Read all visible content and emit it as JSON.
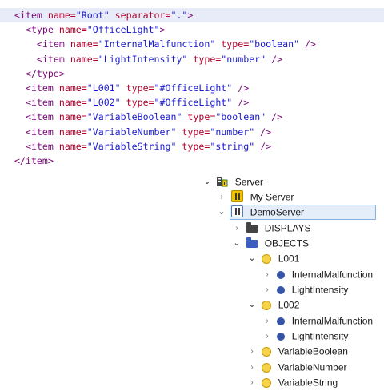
{
  "xml": {
    "lines": [
      {
        "indent": "",
        "parts": [
          [
            "tag",
            "<item "
          ],
          [
            "attr",
            "name="
          ],
          [
            "val",
            "\"Root\""
          ],
          [
            "attr",
            " separator="
          ],
          [
            "val",
            "\".\""
          ],
          [
            "tag",
            ">"
          ]
        ],
        "highlight": true
      },
      {
        "indent": "  ",
        "parts": [
          [
            "tag",
            "<type "
          ],
          [
            "attr",
            "name="
          ],
          [
            "val",
            "\"OfficeLight\""
          ],
          [
            "tag",
            ">"
          ]
        ]
      },
      {
        "indent": "    ",
        "parts": [
          [
            "tag",
            "<item "
          ],
          [
            "attr",
            "name="
          ],
          [
            "val",
            "\"InternalMalfunction\""
          ],
          [
            "attr",
            " type="
          ],
          [
            "val",
            "\"boolean\""
          ],
          [
            "tag",
            " />"
          ]
        ]
      },
      {
        "indent": "    ",
        "parts": [
          [
            "tag",
            "<item "
          ],
          [
            "attr",
            "name="
          ],
          [
            "val",
            "\"LightIntensity\""
          ],
          [
            "attr",
            " type="
          ],
          [
            "val",
            "\"number\""
          ],
          [
            "tag",
            " />"
          ]
        ]
      },
      {
        "indent": "  ",
        "parts": [
          [
            "tag",
            "</type>"
          ]
        ]
      },
      {
        "indent": "  ",
        "parts": [
          [
            "tag",
            "<item "
          ],
          [
            "attr",
            "name="
          ],
          [
            "val",
            "\"L001\""
          ],
          [
            "attr",
            " type="
          ],
          [
            "val",
            "\"#OfficeLight\""
          ],
          [
            "tag",
            " />"
          ]
        ]
      },
      {
        "indent": "  ",
        "parts": [
          [
            "tag",
            "<item "
          ],
          [
            "attr",
            "name="
          ],
          [
            "val",
            "\"L002\""
          ],
          [
            "attr",
            " type="
          ],
          [
            "val",
            "\"#OfficeLight\""
          ],
          [
            "tag",
            " />"
          ]
        ]
      },
      {
        "indent": "  ",
        "parts": [
          [
            "tag",
            "<item "
          ],
          [
            "attr",
            "name="
          ],
          [
            "val",
            "\"VariableBoolean\""
          ],
          [
            "attr",
            " type="
          ],
          [
            "val",
            "\"boolean\""
          ],
          [
            "tag",
            " />"
          ]
        ]
      },
      {
        "indent": "  ",
        "parts": [
          [
            "tag",
            "<item "
          ],
          [
            "attr",
            "name="
          ],
          [
            "val",
            "\"VariableNumber\""
          ],
          [
            "attr",
            " type="
          ],
          [
            "val",
            "\"number\""
          ],
          [
            "tag",
            " />"
          ]
        ]
      },
      {
        "indent": "  ",
        "parts": [
          [
            "tag",
            "<item "
          ],
          [
            "attr",
            "name="
          ],
          [
            "val",
            "\"VariableString\""
          ],
          [
            "attr",
            " type="
          ],
          [
            "val",
            "\"string\""
          ],
          [
            "tag",
            " />"
          ]
        ]
      },
      {
        "indent": "",
        "parts": [
          [
            "tag",
            "</item>"
          ]
        ]
      }
    ]
  },
  "tree": {
    "server": "Server",
    "my_server": "My Server",
    "demo_server": "DemoServer",
    "displays": "DISPLAYS",
    "objects": "OBJECTS",
    "l001": "L001",
    "l001_internal": "InternalMalfunction",
    "l001_light": "LightIntensity",
    "l002": "L002",
    "l002_internal": "InternalMalfunction",
    "l002_light": "LightIntensity",
    "var_boolean": "VariableBoolean",
    "var_number": "VariableNumber",
    "var_string": "VariableString"
  },
  "colors": {
    "xml_tag": "#7a0a7a",
    "xml_attr": "#b5002d",
    "xml_value": "#1a1ad0",
    "highlight_line": "#e8ebf8",
    "selection": "#e3eefa",
    "object_icon": "#f6d24a",
    "variable_icon": "#3653a8",
    "objects_folder": "#3a5fbf"
  },
  "icons": {
    "server": "server-icon",
    "my_server": "plc-icon",
    "demo_server": "plc-icon",
    "displays": "folder-icon",
    "objects": "folder-icon",
    "object": "object-circle-icon",
    "variable": "variable-dot-icon"
  }
}
